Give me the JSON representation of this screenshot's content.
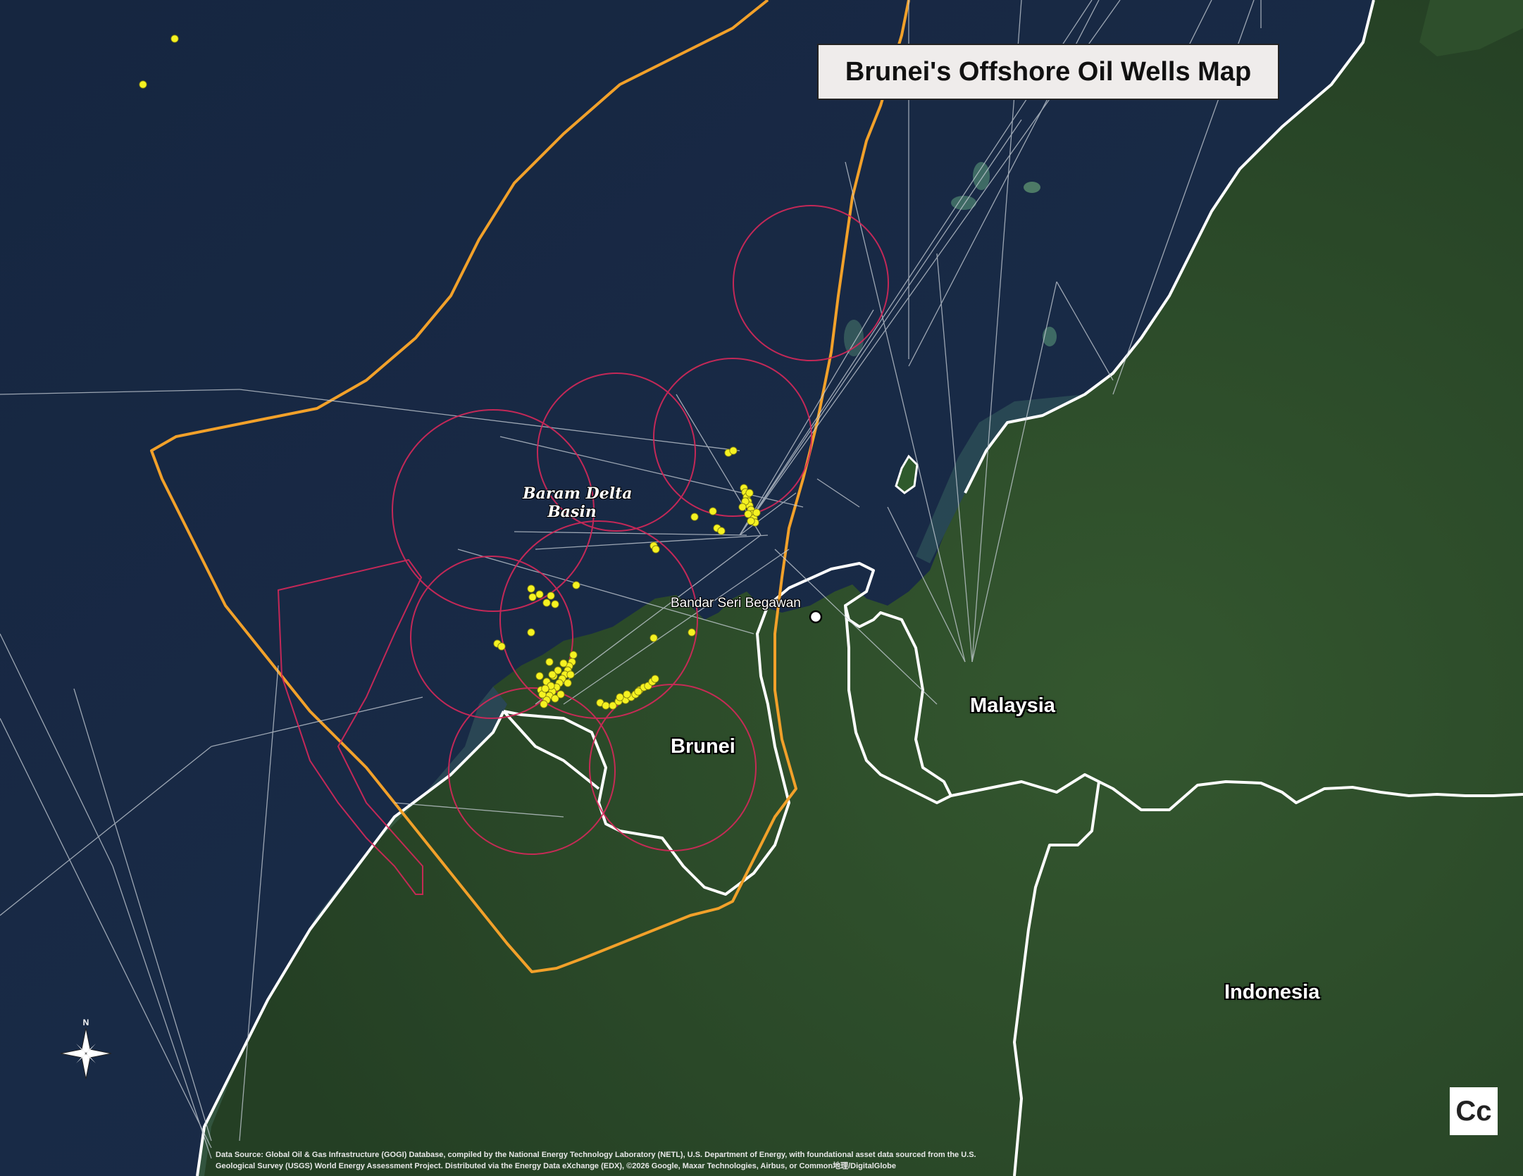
{
  "map": {
    "title": "Brunei's Offshore Oil Wells Map",
    "labels": {
      "basin": [
        "Baram Delta",
        "Basin"
      ],
      "capital": "Bandar Seri Begawan",
      "country_brunei": "Brunei",
      "country_malaysia": "Malaysia",
      "country_indonesia": "Indonesia"
    },
    "north_arrow_letter": "N",
    "credit_line_1": "Data Source: Global Oil & Gas Infrastructure (GOGI) Database, compiled by the National Energy Technology Laboratory (NETL), U.S. Department of Energy, with foundational asset data sourced from the U.S.",
    "credit_line_2": "Geological Survey (USGS) World Energy Assessment Project. Distributed via the Energy Data eXchange (EDX), ©2026 Google, Maxar Technologies, Airbus, or Common地理/DigitalGlobe",
    "logo_text": "Cc",
    "colors": {
      "sea": "#172845",
      "land": "#2b4a2a",
      "well": "#f5f221",
      "eez": "#f2a12a",
      "block": "#d6285a",
      "border": "#ffffff",
      "pipeline": "#c9d0d8"
    },
    "icons": [
      "north-arrow-icon",
      "capital-city-marker-icon",
      "oil-well-marker-icon",
      "publisher-logo-icon"
    ]
  }
}
